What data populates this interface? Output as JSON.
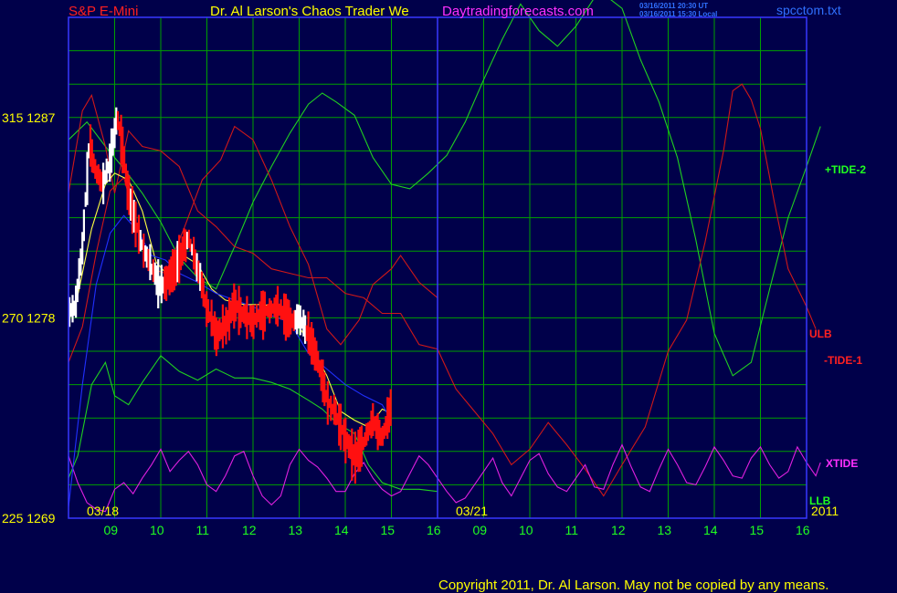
{
  "header": {
    "symbol": "S&P E-Mini",
    "title": "Dr. Al Larson's Chaos Trader We",
    "site": "Daytradingforecasts.com",
    "timestamp_ut": "03/16/2011 20:30 UT",
    "timestamp_local": "03/16/2011 15:30 Local",
    "filename": "spcctom.txt"
  },
  "footer": {
    "copyright": "Copyright 2011, Dr. Al Larson. May not be copied by any means."
  },
  "colors": {
    "background": "#00004a",
    "grid": "#00a000",
    "frame": "#3838ff",
    "price_up": "#ffffff",
    "price_down": "#ff1010",
    "tide_pos": "#20d020",
    "tide_neg": "#d01818",
    "xtide": "#e020e0",
    "avg_yellow": "#ffff40",
    "avg_blue": "#2030ff",
    "symbol_red": "#ff2020",
    "title_yellow": "#ffff00",
    "site_magenta": "#ff30ff",
    "filename_blue": "#3070ff",
    "date_yellow": "#ffff00",
    "day_green": "#20ff20"
  },
  "chart_data": {
    "type": "line",
    "y_labels": [
      {
        "left": "315",
        "right": "1287",
        "value": 1287
      },
      {
        "left": "270",
        "right": "1278",
        "value": 1278
      },
      {
        "left": "225",
        "right": "1269",
        "value": 1269
      }
    ],
    "ylim": [
      1269,
      1291.5
    ],
    "x_days": [
      "09",
      "10",
      "11",
      "12",
      "13",
      "14",
      "15",
      "16",
      "09",
      "10",
      "11",
      "12",
      "13",
      "14",
      "15",
      "16"
    ],
    "date_markers": [
      {
        "label": "03/18",
        "day_index": 0
      },
      {
        "label": "03/21",
        "day_index": 8
      }
    ],
    "year_label": "2011",
    "now_day_index": 8,
    "legend": [
      {
        "name": "+TIDE-2",
        "color": "#20d020"
      },
      {
        "name": "ULB",
        "color": "#d01818"
      },
      {
        "name": "-TIDE-1",
        "color": "#d01818"
      },
      {
        "name": "XTIDE",
        "color": "#e020e0"
      },
      {
        "name": "LLB",
        "color": "#20d020"
      }
    ],
    "series": [
      {
        "key": "tide2_green",
        "color": "#20d020",
        "points": [
          [
            0,
            1286
          ],
          [
            0.4,
            1286.8
          ],
          [
            0.8,
            1285.7
          ],
          [
            1.2,
            1284.7
          ],
          [
            1.6,
            1283.6
          ],
          [
            2.0,
            1282.3
          ],
          [
            2.4,
            1280.7
          ],
          [
            2.8,
            1279.8
          ],
          [
            3.2,
            1279.3
          ],
          [
            3.6,
            1281.2
          ],
          [
            4.0,
            1283.2
          ],
          [
            4.4,
            1284.8
          ],
          [
            4.8,
            1286.3
          ],
          [
            5.2,
            1287.6
          ],
          [
            5.5,
            1288.1
          ],
          [
            5.8,
            1287.7
          ],
          [
            6.2,
            1287.1
          ],
          [
            6.6,
            1285.2
          ],
          [
            7.0,
            1284.0
          ],
          [
            7.4,
            1283.8
          ],
          [
            7.8,
            1284.5
          ],
          [
            8.2,
            1285.3
          ],
          [
            8.6,
            1286.8
          ],
          [
            9.0,
            1288.7
          ],
          [
            9.4,
            1290.5
          ],
          [
            9.8,
            1292.1
          ],
          [
            10.2,
            1290.9
          ],
          [
            10.6,
            1290.2
          ],
          [
            11.0,
            1291.1
          ],
          [
            11.5,
            1292.7
          ],
          [
            12.0,
            1291.9
          ],
          [
            12.4,
            1289.6
          ],
          [
            12.8,
            1287.7
          ],
          [
            13.2,
            1285.2
          ],
          [
            13.6,
            1281.5
          ],
          [
            14.0,
            1277.3
          ],
          [
            14.4,
            1275.4
          ],
          [
            14.8,
            1276.0
          ],
          [
            15.2,
            1279.3
          ],
          [
            15.6,
            1282.5
          ],
          [
            16.0,
            1284.8
          ],
          [
            16.3,
            1286.6
          ]
        ]
      },
      {
        "key": "ulb_red",
        "color": "#d01818",
        "points": [
          [
            0,
            1283.6
          ],
          [
            0.3,
            1287.3
          ],
          [
            0.5,
            1288.0
          ],
          [
            0.8,
            1285.7
          ],
          [
            1.0,
            1283.6
          ],
          [
            1.3,
            1286.4
          ],
          [
            1.6,
            1285.7
          ],
          [
            2.0,
            1285.5
          ],
          [
            2.4,
            1284.8
          ],
          [
            2.8,
            1282.8
          ],
          [
            3.2,
            1282.1
          ],
          [
            3.6,
            1281.2
          ],
          [
            4.0,
            1280.9
          ],
          [
            4.4,
            1280.2
          ],
          [
            4.8,
            1280.0
          ],
          [
            5.2,
            1279.8
          ],
          [
            5.6,
            1279.8
          ],
          [
            6.0,
            1279.1
          ],
          [
            6.4,
            1278.9
          ],
          [
            6.8,
            1278.2
          ],
          [
            7.2,
            1278.2
          ],
          [
            7.6,
            1276.8
          ],
          [
            8.0,
            1276.6
          ],
          [
            8.4,
            1274.8
          ],
          [
            8.8,
            1273.8
          ],
          [
            9.2,
            1272.8
          ],
          [
            9.6,
            1271.4
          ],
          [
            10.0,
            1272.1
          ],
          [
            10.4,
            1273.3
          ],
          [
            10.8,
            1272.3
          ],
          [
            11.2,
            1271.2
          ],
          [
            11.6,
            1270.0
          ],
          [
            12.0,
            1271.4
          ],
          [
            12.5,
            1273.1
          ],
          [
            13.0,
            1276.5
          ],
          [
            13.4,
            1277.9
          ],
          [
            13.8,
            1281.4
          ],
          [
            14.2,
            1285.5
          ],
          [
            14.4,
            1288.2
          ],
          [
            14.6,
            1288.5
          ],
          [
            14.8,
            1287.8
          ],
          [
            15.0,
            1286.5
          ],
          [
            15.3,
            1283.2
          ],
          [
            15.6,
            1280.2
          ],
          [
            16.0,
            1278.5
          ],
          [
            16.2,
            1277.5
          ]
        ]
      },
      {
        "key": "tide1_red",
        "color": "#d01818",
        "points": [
          [
            0,
            1276.0
          ],
          [
            0.3,
            1277.6
          ],
          [
            0.6,
            1280.9
          ],
          [
            0.9,
            1283.7
          ],
          [
            1.2,
            1284.3
          ],
          [
            1.5,
            1282.0
          ],
          [
            1.8,
            1280.2
          ],
          [
            2.1,
            1280.0
          ],
          [
            2.5,
            1282.0
          ],
          [
            2.9,
            1284.2
          ],
          [
            3.3,
            1285.1
          ],
          [
            3.6,
            1286.6
          ],
          [
            4.0,
            1286.0
          ],
          [
            4.4,
            1284.2
          ],
          [
            4.8,
            1282.1
          ],
          [
            5.2,
            1280.4
          ],
          [
            5.6,
            1277.5
          ],
          [
            5.9,
            1276.8
          ],
          [
            6.3,
            1277.9
          ],
          [
            6.6,
            1279.5
          ],
          [
            7.0,
            1280.2
          ],
          [
            7.2,
            1280.8
          ],
          [
            7.6,
            1279.6
          ],
          [
            8.0,
            1278.9
          ]
        ]
      },
      {
        "key": "llb_green",
        "color": "#20d020",
        "points": [
          [
            0,
            1270.8
          ],
          [
            0.2,
            1271.8
          ],
          [
            0.5,
            1275.0
          ],
          [
            0.8,
            1276.0
          ],
          [
            1.0,
            1274.5
          ],
          [
            1.3,
            1274.1
          ],
          [
            1.6,
            1275.1
          ],
          [
            2.0,
            1276.3
          ],
          [
            2.4,
            1275.6
          ],
          [
            2.8,
            1275.2
          ],
          [
            3.2,
            1275.7
          ],
          [
            3.6,
            1275.3
          ],
          [
            4.0,
            1275.3
          ],
          [
            4.4,
            1275.1
          ],
          [
            4.8,
            1274.8
          ],
          [
            5.2,
            1274.3
          ],
          [
            5.5,
            1273.9
          ],
          [
            5.8,
            1273.3
          ],
          [
            6.2,
            1272.8
          ],
          [
            6.5,
            1271.4
          ],
          [
            6.8,
            1270.6
          ],
          [
            7.2,
            1270.3
          ],
          [
            7.6,
            1270.3
          ],
          [
            8.0,
            1270.2
          ]
        ]
      },
      {
        "key": "xtide_magenta",
        "color": "#e020e0",
        "points": [
          [
            0,
            1271.8
          ],
          [
            0.2,
            1270.6
          ],
          [
            0.4,
            1269.7
          ],
          [
            0.6,
            1269.4
          ],
          [
            0.8,
            1269.3
          ],
          [
            1.0,
            1270.3
          ],
          [
            1.2,
            1270.6
          ],
          [
            1.4,
            1270.1
          ],
          [
            1.6,
            1270.8
          ],
          [
            1.8,
            1271.4
          ],
          [
            2.0,
            1272.1
          ],
          [
            2.2,
            1271.1
          ],
          [
            2.4,
            1271.6
          ],
          [
            2.6,
            1272.0
          ],
          [
            2.8,
            1271.4
          ],
          [
            3.0,
            1270.5
          ],
          [
            3.2,
            1270.2
          ],
          [
            3.4,
            1270.9
          ],
          [
            3.6,
            1271.8
          ],
          [
            3.8,
            1272.0
          ],
          [
            4.0,
            1270.9
          ],
          [
            4.2,
            1270.0
          ],
          [
            4.4,
            1269.6
          ],
          [
            4.6,
            1270.0
          ],
          [
            4.8,
            1271.4
          ],
          [
            5.0,
            1272.1
          ],
          [
            5.2,
            1271.6
          ],
          [
            5.4,
            1271.3
          ],
          [
            5.6,
            1270.8
          ],
          [
            5.8,
            1270.2
          ],
          [
            6.0,
            1270.2
          ],
          [
            6.2,
            1271.0
          ],
          [
            6.4,
            1271.5
          ],
          [
            6.6,
            1270.8
          ],
          [
            6.8,
            1270.3
          ],
          [
            7.0,
            1270.0
          ],
          [
            7.2,
            1270.2
          ],
          [
            7.4,
            1271.0
          ],
          [
            7.6,
            1271.8
          ],
          [
            7.8,
            1271.4
          ],
          [
            8.0,
            1270.8
          ],
          [
            8.2,
            1270.2
          ],
          [
            8.4,
            1269.7
          ],
          [
            8.6,
            1269.9
          ],
          [
            8.8,
            1270.5
          ],
          [
            9.0,
            1271.1
          ],
          [
            9.2,
            1271.7
          ],
          [
            9.4,
            1270.6
          ],
          [
            9.6,
            1270.0
          ],
          [
            9.8,
            1270.8
          ],
          [
            10.0,
            1271.6
          ],
          [
            10.2,
            1271.9
          ],
          [
            10.4,
            1271.0
          ],
          [
            10.6,
            1270.4
          ],
          [
            10.8,
            1270.2
          ],
          [
            11.0,
            1270.8
          ],
          [
            11.2,
            1271.4
          ],
          [
            11.4,
            1270.4
          ],
          [
            11.6,
            1270.3
          ],
          [
            11.8,
            1271.4
          ],
          [
            12.0,
            1272.3
          ],
          [
            12.2,
            1271.3
          ],
          [
            12.4,
            1270.4
          ],
          [
            12.6,
            1270.2
          ],
          [
            12.8,
            1271.2
          ],
          [
            13.0,
            1272.1
          ],
          [
            13.2,
            1271.4
          ],
          [
            13.4,
            1270.6
          ],
          [
            13.6,
            1270.5
          ],
          [
            13.8,
            1271.3
          ],
          [
            14.0,
            1272.2
          ],
          [
            14.2,
            1271.6
          ],
          [
            14.4,
            1270.9
          ],
          [
            14.6,
            1270.8
          ],
          [
            14.8,
            1271.7
          ],
          [
            15.0,
            1272.2
          ],
          [
            15.2,
            1271.4
          ],
          [
            15.4,
            1270.8
          ],
          [
            15.6,
            1271.1
          ],
          [
            15.8,
            1272.2
          ],
          [
            16.0,
            1271.5
          ],
          [
            16.2,
            1270.9
          ],
          [
            16.3,
            1271.5
          ]
        ]
      },
      {
        "key": "avg_yellow",
        "color": "#ffff40",
        "points": [
          [
            0.2,
            1279
          ],
          [
            0.5,
            1282
          ],
          [
            0.8,
            1284
          ],
          [
            1.0,
            1284.5
          ],
          [
            1.3,
            1284.2
          ],
          [
            1.6,
            1282.8
          ],
          [
            1.9,
            1280.5
          ],
          [
            2.2,
            1279.8
          ],
          [
            2.5,
            1280.8
          ],
          [
            2.8,
            1280.4
          ],
          [
            3.1,
            1279.3
          ],
          [
            3.4,
            1278.8
          ],
          [
            3.8,
            1278.6
          ],
          [
            4.2,
            1278.6
          ],
          [
            4.6,
            1278.5
          ],
          [
            5.0,
            1277.6
          ],
          [
            5.3,
            1276.6
          ],
          [
            5.6,
            1275.4
          ],
          [
            5.9,
            1273.8
          ],
          [
            6.2,
            1273.4
          ],
          [
            6.5,
            1273.1
          ],
          [
            6.8,
            1273.9
          ],
          [
            7.0,
            1273.7
          ]
        ]
      },
      {
        "key": "avg_blue",
        "color": "#2030ff",
        "points": [
          [
            0,
            1269.5
          ],
          [
            0.3,
            1275.0
          ],
          [
            0.6,
            1279.5
          ],
          [
            0.9,
            1281.8
          ],
          [
            1.2,
            1282.6
          ],
          [
            1.5,
            1281.9
          ],
          [
            1.8,
            1280.8
          ],
          [
            2.1,
            1280.6
          ],
          [
            2.4,
            1280.0
          ],
          [
            2.8,
            1279.6
          ],
          [
            3.2,
            1279.1
          ],
          [
            3.6,
            1278.8
          ],
          [
            4.0,
            1278.5
          ],
          [
            4.4,
            1278.1
          ],
          [
            4.8,
            1277.8
          ],
          [
            5.2,
            1276.4
          ],
          [
            5.6,
            1275.7
          ],
          [
            6.0,
            1275.0
          ],
          [
            6.4,
            1274.5
          ],
          [
            6.8,
            1274.1
          ],
          [
            7.0,
            1273.4
          ]
        ]
      }
    ]
  }
}
